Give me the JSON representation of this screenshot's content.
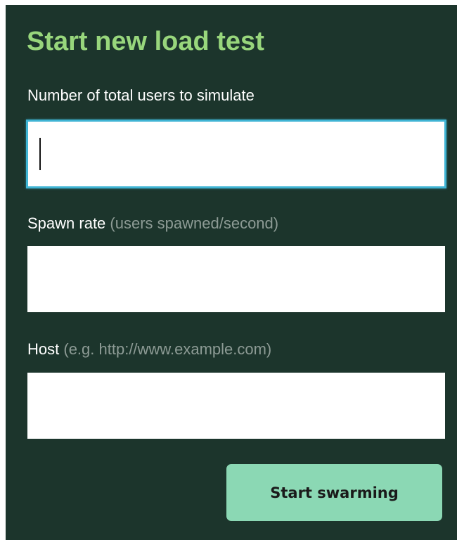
{
  "form": {
    "title": "Start new load test",
    "users": {
      "label": "Number of total users to simulate",
      "value": ""
    },
    "spawn_rate": {
      "label": "Spawn rate",
      "hint": "(users spawned/second)",
      "value": ""
    },
    "host": {
      "label": "Host",
      "hint": "(e.g. http://www.example.com)",
      "value": ""
    },
    "submit_label": "Start swarming"
  },
  "colors": {
    "panel_background": "#1c352c",
    "title": "#98d67c",
    "hint": "#8d9b95",
    "button_background": "#8bd8b4",
    "focus_border": "#3fb4d4"
  }
}
